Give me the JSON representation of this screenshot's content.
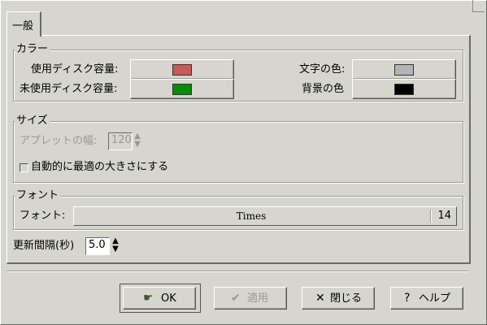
{
  "tab": {
    "label": "一般"
  },
  "colors": {
    "legend": "カラー",
    "used_label": "使用ディスク容量:",
    "used_color": "#c85a5a",
    "unused_label": "未使用ディスク容量:",
    "unused_color": "#0a8a0a",
    "text_label": "文字の色:",
    "text_color": "#b4b4b4",
    "bg_label": "背景の色",
    "bg_color": "#000000"
  },
  "size": {
    "legend": "サイズ",
    "width_label": "アプレットの幅:",
    "width_value": "120",
    "auto_label": "自動的に最適の大きさにする",
    "auto_checked": false
  },
  "font": {
    "legend": "フォント",
    "label": "フォント:",
    "name": "Times",
    "size": "14"
  },
  "interval": {
    "label": "更新間隔(秒)",
    "value": "5.0"
  },
  "buttons": {
    "ok": "OK",
    "apply": "適用",
    "close": "閉じる",
    "help": "ヘルプ"
  }
}
